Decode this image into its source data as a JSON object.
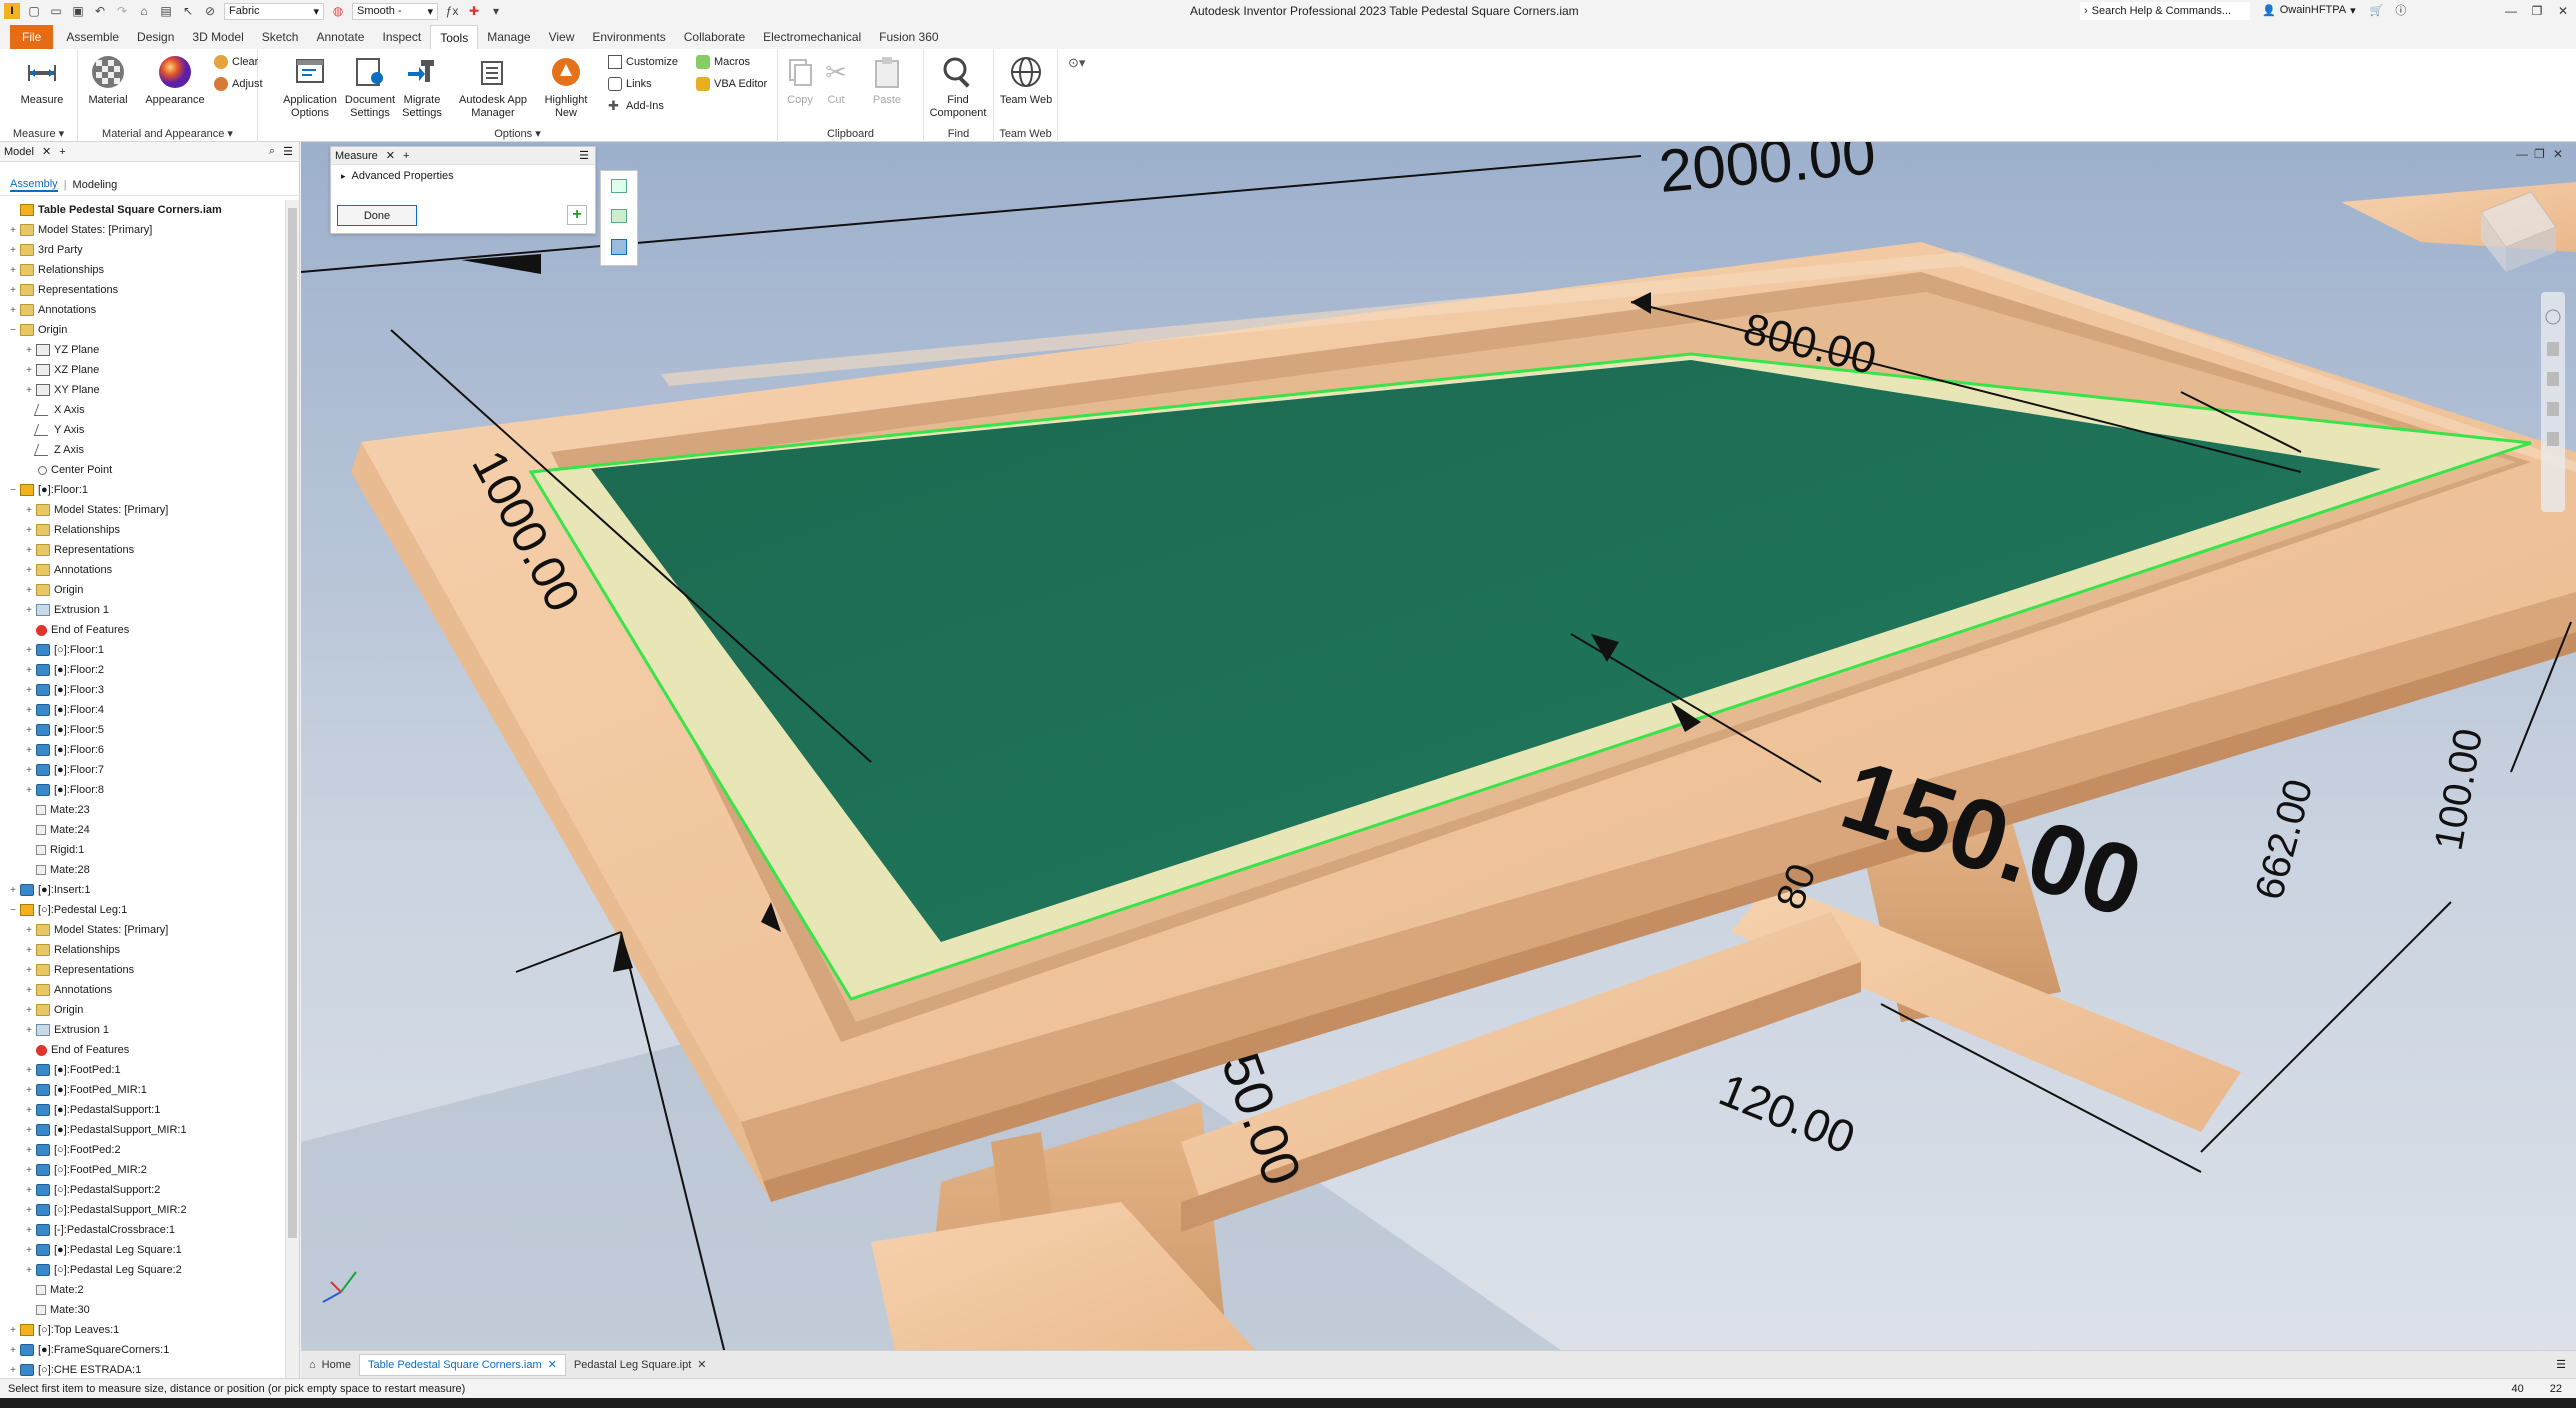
{
  "app": {
    "title": "Autodesk Inventor Professional 2023   Table Pedestal Square Corners.iam",
    "quick_access": {
      "appearance_select": "Fabric",
      "visual_style_select": "Smooth -"
    },
    "search_placeholder": "Search Help & Commands...",
    "user": "OwainHFTPA"
  },
  "ribbon_tabs": [
    "File",
    "Assemble",
    "Design",
    "3D Model",
    "Sketch",
    "Annotate",
    "Inspect",
    "Tools",
    "Manage",
    "View",
    "Environments",
    "Collaborate",
    "Electromechanical",
    "Fusion 360"
  ],
  "active_tab": "Tools",
  "ribbon": {
    "measure": {
      "button": "Measure",
      "group": "Measure"
    },
    "material_appearance": {
      "material": "Material",
      "appearance": "Appearance",
      "clear": "Clear",
      "adjust": "Adjust",
      "group": "Material and Appearance"
    },
    "options": {
      "app_options": "Application Options",
      "doc_settings": "Document Settings",
      "migrate": "Migrate Settings",
      "app_manager": "Autodesk App Manager",
      "highlight": "Highlight New",
      "customize": "Customize",
      "links": "Links",
      "addins": "Add-Ins",
      "macros": "Macros",
      "vba": "VBA Editor",
      "group": "Options"
    },
    "clipboard": {
      "copy": "Copy",
      "cut": "Cut",
      "paste": "Paste",
      "group": "Clipboard"
    },
    "find": {
      "button": "Find Component",
      "group": "Find"
    },
    "teamweb": {
      "button": "Team Web",
      "group": "Team Web"
    }
  },
  "browser": {
    "tab": "Model",
    "subtabs": [
      "Assembly",
      "Modeling"
    ],
    "tree": [
      {
        "label": "Table Pedestal Square Corners.iam",
        "icon": "asm",
        "level": 0,
        "exp": "",
        "top": true
      },
      {
        "label": "Model States: [Primary]",
        "icon": "folder",
        "level": 0,
        "exp": "+"
      },
      {
        "label": "3rd Party",
        "icon": "folder",
        "level": 0,
        "exp": "+"
      },
      {
        "label": "Relationships",
        "icon": "folder",
        "level": 0,
        "exp": "+"
      },
      {
        "label": "Representations",
        "icon": "folder",
        "level": 0,
        "exp": "+"
      },
      {
        "label": "Annotations",
        "icon": "folder",
        "level": 0,
        "exp": "+"
      },
      {
        "label": "Origin",
        "icon": "folder",
        "level": 0,
        "exp": "−"
      },
      {
        "label": "YZ Plane",
        "icon": "plane",
        "level": 1,
        "exp": "+"
      },
      {
        "label": "XZ Plane",
        "icon": "plane",
        "level": 1,
        "exp": "+"
      },
      {
        "label": "XY Plane",
        "icon": "plane",
        "level": 1,
        "exp": "+"
      },
      {
        "label": "X Axis",
        "icon": "axis",
        "level": 1,
        "exp": ""
      },
      {
        "label": "Y Axis",
        "icon": "axis",
        "level": 1,
        "exp": ""
      },
      {
        "label": "Z Axis",
        "icon": "axis",
        "level": 1,
        "exp": ""
      },
      {
        "label": "Center Point",
        "icon": "point",
        "level": 1,
        "exp": ""
      },
      {
        "label": "[●]:Floor:1",
        "icon": "asm",
        "level": 0,
        "exp": "−"
      },
      {
        "label": "Model States: [Primary]",
        "icon": "folder",
        "level": 1,
        "exp": "+"
      },
      {
        "label": "Relationships",
        "icon": "folder",
        "level": 1,
        "exp": "+"
      },
      {
        "label": "Representations",
        "icon": "folder",
        "level": 1,
        "exp": "+"
      },
      {
        "label": "Annotations",
        "icon": "folder",
        "level": 1,
        "exp": "+"
      },
      {
        "label": "Origin",
        "icon": "folder",
        "level": 1,
        "exp": "+"
      },
      {
        "label": "Extrusion 1",
        "icon": "feat",
        "level": 1,
        "exp": "+"
      },
      {
        "label": "End of Features",
        "icon": "end",
        "level": 1,
        "exp": ""
      },
      {
        "label": "[○]:Floor:1",
        "icon": "part",
        "level": 1,
        "exp": "+"
      },
      {
        "label": "[●]:Floor:2",
        "icon": "part",
        "level": 1,
        "exp": "+"
      },
      {
        "label": "[●]:Floor:3",
        "icon": "part",
        "level": 1,
        "exp": "+"
      },
      {
        "label": "[●]:Floor:4",
        "icon": "part",
        "level": 1,
        "exp": "+"
      },
      {
        "label": "[●]:Floor:5",
        "icon": "part",
        "level": 1,
        "exp": "+"
      },
      {
        "label": "[●]:Floor:6",
        "icon": "part",
        "level": 1,
        "exp": "+"
      },
      {
        "label": "[●]:Floor:7",
        "icon": "part",
        "level": 1,
        "exp": "+"
      },
      {
        "label": "[●]:Floor:8",
        "icon": "part",
        "level": 1,
        "exp": "+"
      },
      {
        "label": "Mate:23",
        "icon": "mate",
        "level": 1,
        "exp": ""
      },
      {
        "label": "Mate:24",
        "icon": "mate",
        "level": 1,
        "exp": ""
      },
      {
        "label": "Rigid:1",
        "icon": "mate",
        "level": 1,
        "exp": ""
      },
      {
        "label": "Mate:28",
        "icon": "mate",
        "level": 1,
        "exp": ""
      },
      {
        "label": "[●]:Insert:1",
        "icon": "part",
        "level": 0,
        "exp": "+"
      },
      {
        "label": "[○]:Pedestal Leg:1",
        "icon": "asm",
        "level": 0,
        "exp": "−"
      },
      {
        "label": "Model States: [Primary]",
        "icon": "folder",
        "level": 1,
        "exp": "+"
      },
      {
        "label": "Relationships",
        "icon": "folder",
        "level": 1,
        "exp": "+"
      },
      {
        "label": "Representations",
        "icon": "folder",
        "level": 1,
        "exp": "+"
      },
      {
        "label": "Annotations",
        "icon": "folder",
        "level": 1,
        "exp": "+"
      },
      {
        "label": "Origin",
        "icon": "folder",
        "level": 1,
        "exp": "+"
      },
      {
        "label": "Extrusion 1",
        "icon": "feat",
        "level": 1,
        "exp": "+"
      },
      {
        "label": "End of Features",
        "icon": "end",
        "level": 1,
        "exp": ""
      },
      {
        "label": "[●]:FootPed:1",
        "icon": "part",
        "level": 1,
        "exp": "+"
      },
      {
        "label": "[●]:FootPed_MIR:1",
        "icon": "part",
        "level": 1,
        "exp": "+"
      },
      {
        "label": "[●]:PedastalSupport:1",
        "icon": "part",
        "level": 1,
        "exp": "+"
      },
      {
        "label": "[●]:PedastalSupport_MIR:1",
        "icon": "part",
        "level": 1,
        "exp": "+"
      },
      {
        "label": "[○]:FootPed:2",
        "icon": "part",
        "level": 1,
        "exp": "+"
      },
      {
        "label": "[○]:FootPed_MIR:2",
        "icon": "part",
        "level": 1,
        "exp": "+"
      },
      {
        "label": "[○]:PedastalSupport:2",
        "icon": "part",
        "level": 1,
        "exp": "+"
      },
      {
        "label": "[○]:PedastalSupport_MIR:2",
        "icon": "part",
        "level": 1,
        "exp": "+"
      },
      {
        "label": "[-]:PedastalCrossbrace:1",
        "icon": "part",
        "level": 1,
        "exp": "+"
      },
      {
        "label": "[●]:Pedastal Leg Square:1",
        "icon": "part",
        "level": 1,
        "exp": "+"
      },
      {
        "label": "[○]:Pedastal Leg Square:2",
        "icon": "part",
        "level": 1,
        "exp": "+"
      },
      {
        "label": "Mate:2",
        "icon": "mate",
        "level": 1,
        "exp": ""
      },
      {
        "label": "Mate:30",
        "icon": "mate",
        "level": 1,
        "exp": ""
      },
      {
        "label": "[○]:Top Leaves:1",
        "icon": "asm",
        "level": 0,
        "exp": "+"
      },
      {
        "label": "[●]:FrameSquareCorners:1",
        "icon": "part",
        "level": 0,
        "exp": "+"
      },
      {
        "label": "[○]:CHE ESTRADA:1",
        "icon": "part",
        "level": 0,
        "exp": "+"
      }
    ]
  },
  "measure_panel": {
    "tab": "Measure",
    "advanced": "Advanced Properties",
    "done": "Done"
  },
  "dimensions": [
    "2000.00",
    "800.00",
    "1000.00",
    "150.00",
    "662.00",
    "100.00",
    "120.00",
    "50.00",
    "80"
  ],
  "doc_tabs": [
    "Home",
    "Table Pedestal Square Corners.iam",
    "Pedastal Leg Square.ipt"
  ],
  "status": {
    "message": "Select first item to measure size, distance or position (or pick empty space to restart measure)",
    "n1": "40",
    "n2": "22"
  },
  "colors": {
    "accent": "#0b6ec5",
    "file_tab": "#e56c14",
    "selection": "#39e34a",
    "felt": "#1e6f55",
    "wood": "#f0c49c"
  }
}
